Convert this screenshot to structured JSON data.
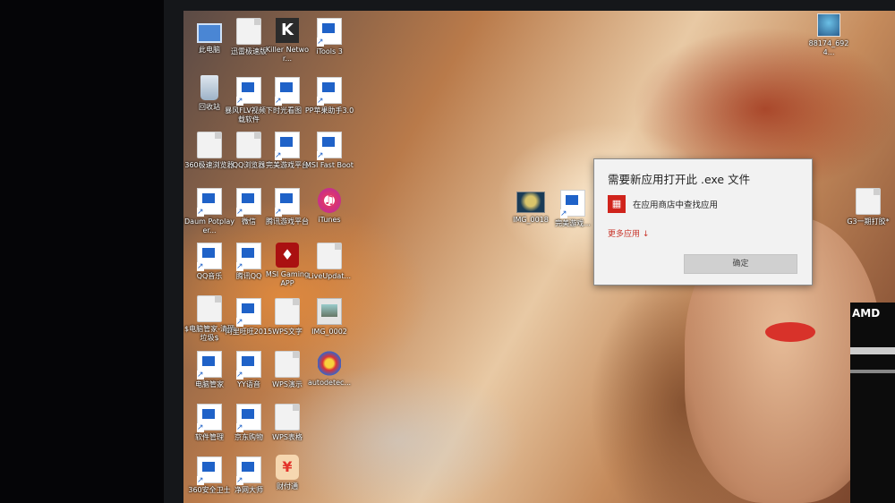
{
  "desktop": {
    "icons_col1": [
      {
        "label": "此电脑",
        "icon": "computer-icon"
      },
      {
        "label": "回收站",
        "icon": "recycle-bin-icon"
      },
      {
        "label": "360极速浏览器",
        "icon": "browser-icon"
      },
      {
        "label": "Daum Potplayer...",
        "icon": "video-player-icon"
      },
      {
        "label": "QQ音乐",
        "icon": "music-icon"
      },
      {
        "label": "$电脑管家-清理垃圾$",
        "icon": "file-icon"
      },
      {
        "label": "电脑管家",
        "icon": "shield-icon"
      },
      {
        "label": "软件管理",
        "icon": "app-icon"
      },
      {
        "label": "360安全卫士",
        "icon": "shield-icon"
      }
    ],
    "icons_col2": [
      {
        "label": "迅雷极速版",
        "icon": "download-icon"
      },
      {
        "label": "暴风FLV视频下载软件",
        "icon": "download-icon"
      },
      {
        "label": "QQ浏览器",
        "icon": "browser-icon"
      },
      {
        "label": "微信",
        "icon": "chat-icon"
      },
      {
        "label": "腾讯QQ",
        "icon": "chat-icon"
      },
      {
        "label": "阿里旺旺2015",
        "icon": "chat-icon"
      },
      {
        "label": "YY语音",
        "icon": "voice-icon"
      },
      {
        "label": "京东购物",
        "icon": "shopping-icon"
      },
      {
        "label": "净网大师",
        "icon": "app-icon"
      }
    ],
    "icons_col3": [
      {
        "label": "Killer Networ...",
        "icon": "k-logo-icon"
      },
      {
        "label": "时光看图",
        "icon": "image-viewer-icon"
      },
      {
        "label": "完美游戏平台",
        "icon": "game-icon"
      },
      {
        "label": "腾讯游戏平台",
        "icon": "game-icon"
      },
      {
        "label": "MSI Gaming APP",
        "icon": "msi-dragon-icon"
      },
      {
        "label": "WPS文字",
        "icon": "document-icon"
      },
      {
        "label": "WPS演示",
        "icon": "presentation-icon"
      },
      {
        "label": "WPS表格",
        "icon": "spreadsheet-icon"
      },
      {
        "label": "财付通",
        "icon": "wallet-icon"
      }
    ],
    "icons_col4": [
      {
        "label": "iTools 3",
        "icon": "tools-icon"
      },
      {
        "label": "PP苹果助手3.0",
        "icon": "app-icon"
      },
      {
        "label": "MSI Fast Boot",
        "icon": "boot-icon"
      },
      {
        "label": "iTunes",
        "icon": "itunes-icon"
      },
      {
        "label": "LiveUpdat...",
        "icon": "file-icon"
      },
      {
        "label": "IMG_0002",
        "icon": "image-icon"
      },
      {
        "label": "autodetec...",
        "icon": "autodetect-icon"
      }
    ],
    "middle_icons": [
      {
        "label": "IMG_0018",
        "icon": "photo-icon"
      },
      {
        "label": "完美游戏...",
        "icon": "game-icon"
      }
    ],
    "right_icons": [
      {
        "label": "88174_6924...",
        "icon": "avatar-icon"
      },
      {
        "label": "G3一期打胶*",
        "icon": "folder-icon"
      }
    ]
  },
  "dialog": {
    "title": "需要新应用打开此 .exe 文件",
    "store_option": "在应用商店中查找应用",
    "more_apps": "更多应用 ↓",
    "ok_button": "确定"
  },
  "sticker": {
    "brand": "AMD"
  }
}
